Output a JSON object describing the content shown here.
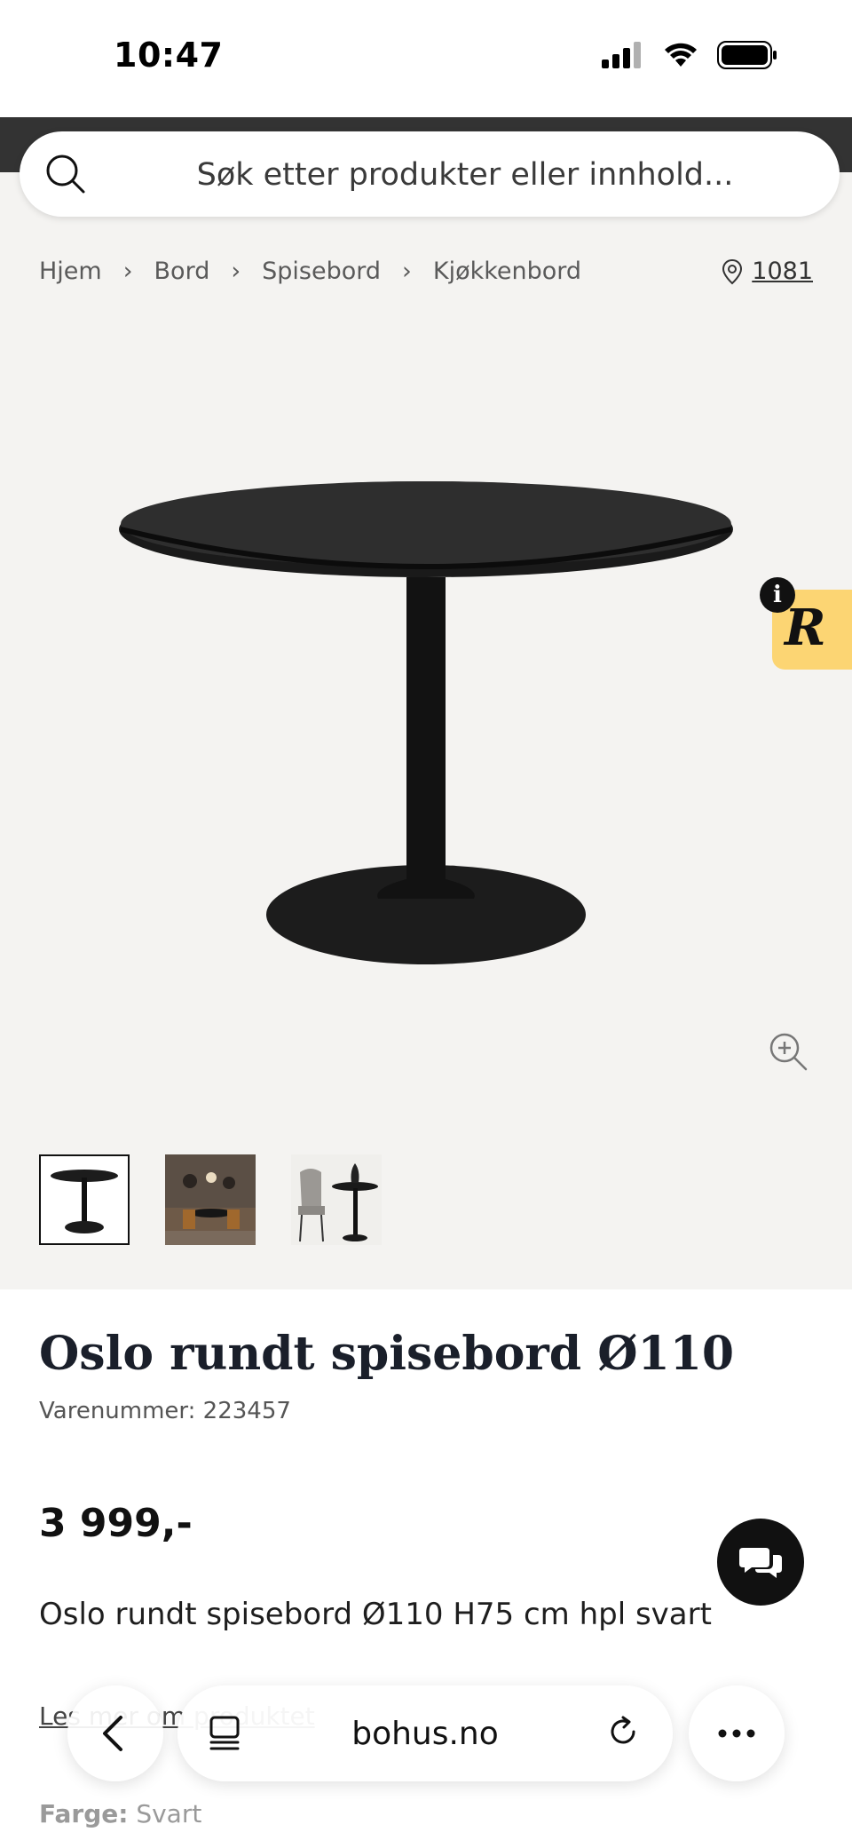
{
  "status_bar": {
    "time": "10:47"
  },
  "search": {
    "placeholder": "Søk etter produkter eller innhold..."
  },
  "breadcrumb": {
    "items": [
      "Hjem",
      "Bord",
      "Spisebord",
      "Kjøkkenbord"
    ],
    "separator": "›"
  },
  "store": {
    "code": "1081"
  },
  "badge": {
    "letter": "R",
    "info": "i"
  },
  "product": {
    "title": "Oslo rundt spisebord Ø110",
    "sku_label": "Varenummer: 223457",
    "price": "3 999,-",
    "description": "Oslo rundt spisebord Ø110 H75 cm hpl svart",
    "read_more": "Les mer om produktet",
    "color_label": "Farge:",
    "color_value": "Svart"
  },
  "browser": {
    "url": "bohus.no"
  },
  "colors": {
    "accent": "#111111",
    "badge_bg": "#fcd573",
    "gallery_bg": "#f4f3f1",
    "top_dark": "#333333"
  }
}
